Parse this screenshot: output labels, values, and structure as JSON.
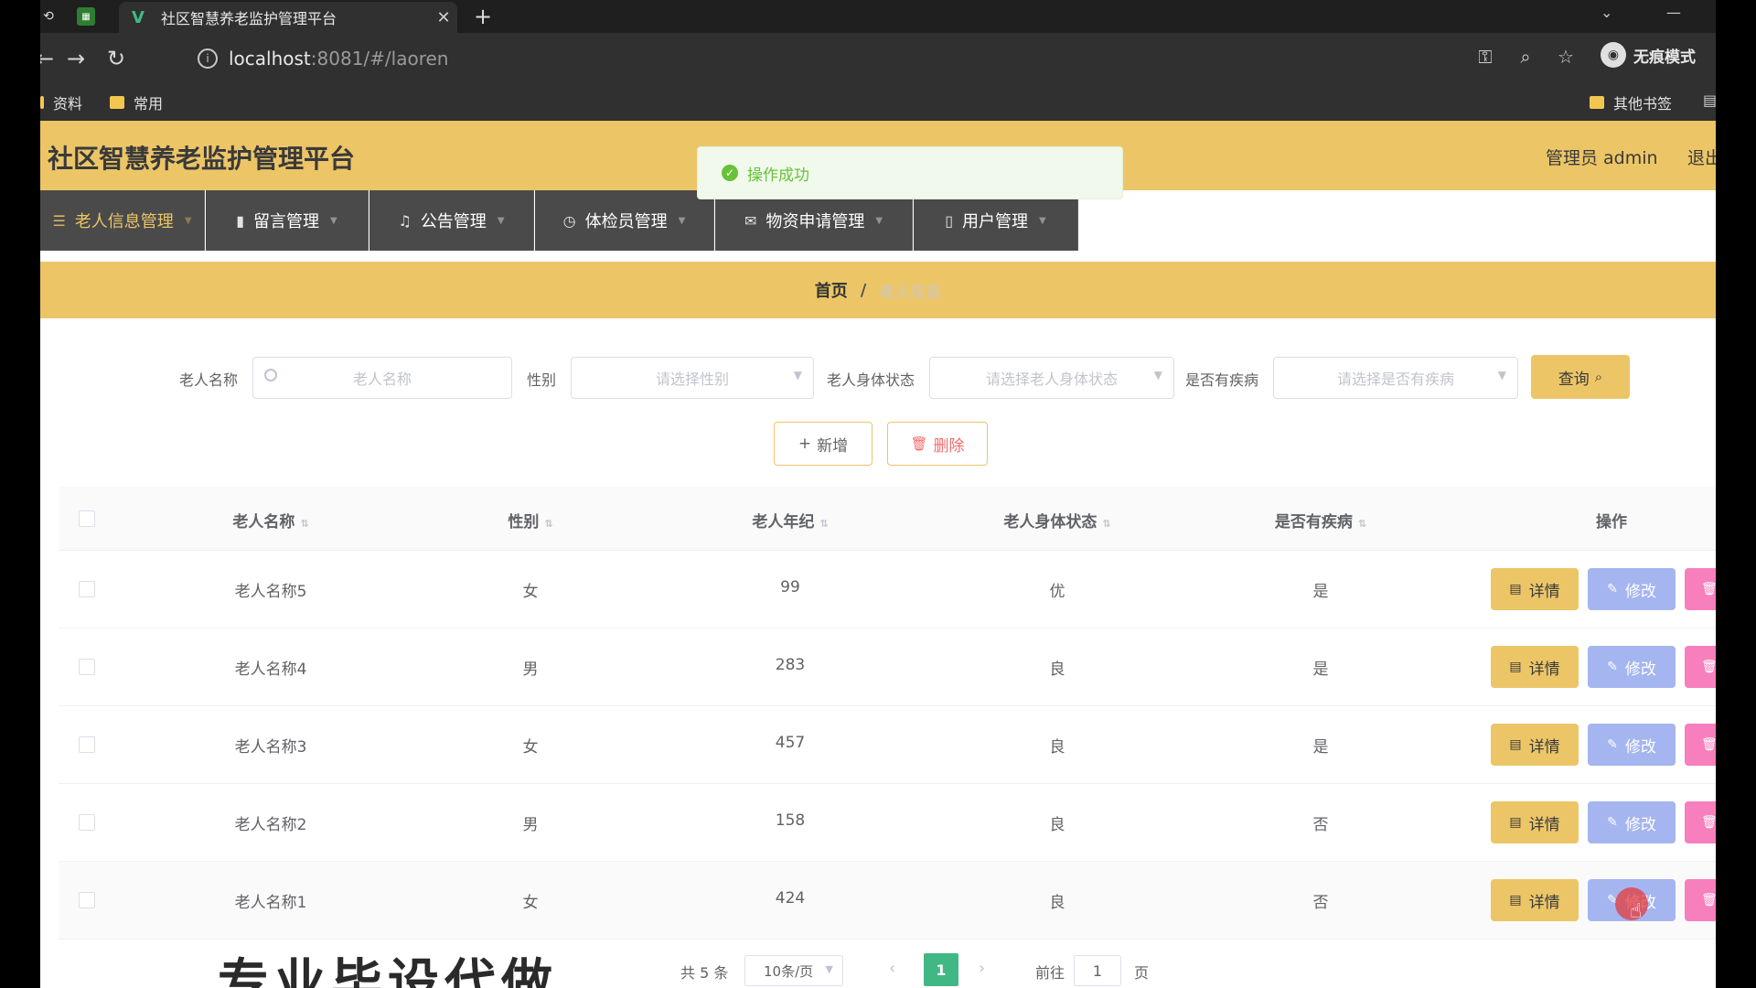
{
  "browser": {
    "tab_title": "社区智慧养老监护管理平台",
    "tab_close": "✕",
    "new_tab": "+",
    "url_host": "localhost",
    "url_rest": ":8081/#/laoren",
    "incognito_label": "无痕模式",
    "bookmarks": [
      "资料",
      "常用"
    ],
    "other_bookmarks": "其他书签"
  },
  "app": {
    "title": "社区智慧养老监护管理平台",
    "admin_label": "管理员 admin",
    "logout_label": "退出"
  },
  "menu": [
    {
      "label": "老人信息管理",
      "icon": "list-icon",
      "active": true
    },
    {
      "label": "留言管理",
      "icon": "chart-icon",
      "active": false
    },
    {
      "label": "公告管理",
      "icon": "bell-icon",
      "active": false
    },
    {
      "label": "体检员管理",
      "icon": "clock-icon",
      "active": false
    },
    {
      "label": "物资申请管理",
      "icon": "mail-icon",
      "active": false
    },
    {
      "label": "用户管理",
      "icon": "phone-icon",
      "active": false
    }
  ],
  "toast": {
    "message": "操作成功"
  },
  "breadcrumb": {
    "home": "首页",
    "sep": "/",
    "current": "老人信息"
  },
  "search": {
    "name_label": "老人名称",
    "name_placeholder": "老人名称",
    "gender_label": "性别",
    "gender_placeholder": "请选择性别",
    "status_label": "老人身体状态",
    "status_placeholder": "请选择老人身体状态",
    "disease_label": "是否有疾病",
    "disease_placeholder": "请选择是否有疾病",
    "query_label": "查询"
  },
  "actions": {
    "add_label": "新增",
    "delete_label": "删除"
  },
  "table": {
    "headers": [
      "老人名称",
      "性别",
      "老人年纪",
      "老人身体状态",
      "是否有疾病",
      "操作"
    ],
    "rows": [
      {
        "name": "老人名称5",
        "gender": "女",
        "age": "99",
        "status": "优",
        "disease": "是"
      },
      {
        "name": "老人名称4",
        "gender": "男",
        "age": "283",
        "status": "良",
        "disease": "是"
      },
      {
        "name": "老人名称3",
        "gender": "女",
        "age": "457",
        "status": "良",
        "disease": "是"
      },
      {
        "name": "老人名称2",
        "gender": "男",
        "age": "158",
        "status": "良",
        "disease": "否"
      },
      {
        "name": "老人名称1",
        "gender": "女",
        "age": "424",
        "status": "良",
        "disease": "否"
      }
    ],
    "row_actions": {
      "detail": "详情",
      "edit": "修改",
      "delete": "删除"
    }
  },
  "pagination": {
    "total": "共 5 条",
    "page_size": "10条/页",
    "current_page": "1",
    "goto_label": "前往",
    "goto_value": "1",
    "page_suffix": "页"
  },
  "colors": {
    "accent": "#ecc567",
    "menu_bg": "#4a4a4a",
    "success": "#67c23a",
    "edit": "#a5b5f0",
    "delete": "#f77fbd",
    "pager": "#41b883"
  }
}
